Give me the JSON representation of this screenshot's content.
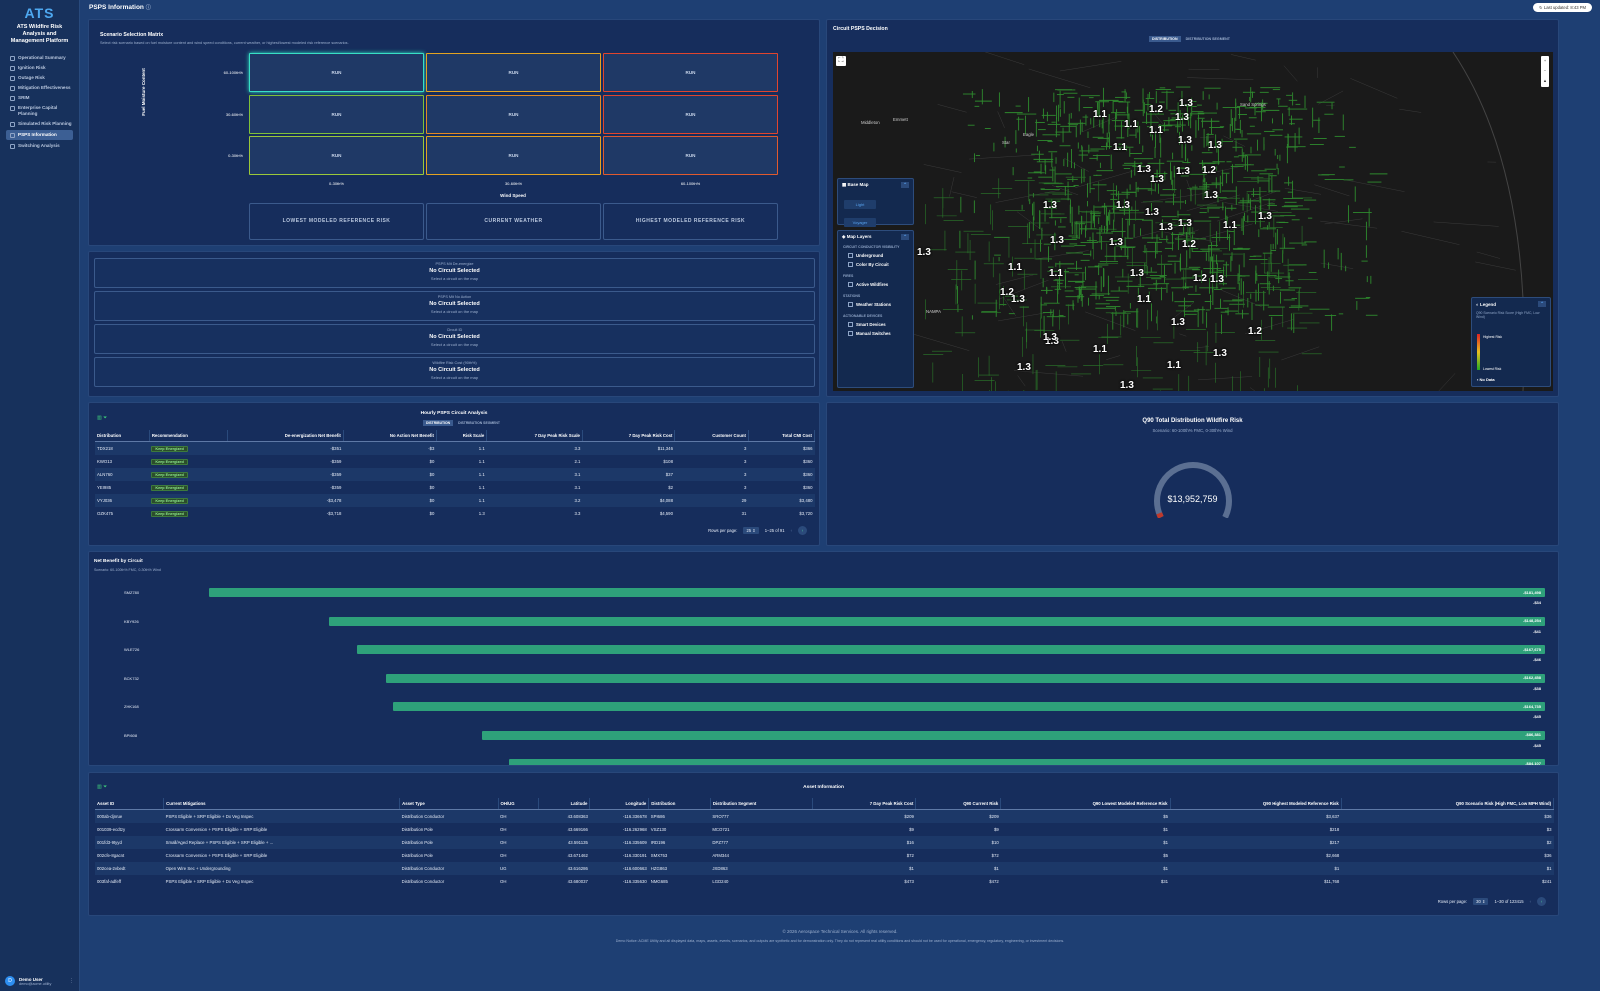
{
  "app": {
    "logo": "ATS",
    "title": "ATS Wildfire Risk Analysis and Management Platform"
  },
  "sidebar": {
    "items": [
      {
        "label": "Operational Summary"
      },
      {
        "label": "Ignition Risk"
      },
      {
        "label": "Outage Risk"
      },
      {
        "label": "Mitigation Effectiveness"
      },
      {
        "label": "SRIM"
      },
      {
        "label": "Enterprise Capital Planning"
      },
      {
        "label": "Simulated Risk Planning"
      },
      {
        "label": "PSPS Information"
      },
      {
        "label": "Switching Analysis"
      }
    ]
  },
  "user": {
    "initial": "D",
    "name": "Demo User",
    "email": "demo@acme.utility"
  },
  "header": {
    "title": "PSPS Information",
    "last_updated": "Last updated: 8:43 PM"
  },
  "matrix": {
    "title": "Scenario Selection Matrix",
    "subtitle": "Select risk scenario based on fuel moisture content and wind speed conditions, current weather, or highest/lowest modeled risk reference scenarios.",
    "y_label": "Fuel Moisture Content",
    "x_label": "Wind Speed",
    "row_labels": [
      "60-100th%",
      "30-60th%",
      "0-30th%"
    ],
    "col_labels": [
      "0-30th%",
      "30-60th%",
      "60-100th%"
    ],
    "cell_label": "RUN",
    "buttons": [
      "LOWEST MODELED REFERENCE RISK",
      "CURRENT WEATHER",
      "HIGHEST MODELED REFERENCE RISK"
    ]
  },
  "circuit_info": [
    {
      "label": "PSPS Mit De-energize",
      "value": "No Circuit Selected",
      "sub": "Select a circuit on the map"
    },
    {
      "label": "PSPS Mit No Action",
      "value": "No Circuit Selected",
      "sub": "Select a circuit on the map"
    },
    {
      "label": "Circuit ID",
      "value": "No Circuit Selected",
      "sub": "Select a circuit on the map"
    },
    {
      "label": "Wildfire Risk Cost (90th%)",
      "value": "No Circuit Selected",
      "sub": "Select a circuit on the map"
    }
  ],
  "decision": {
    "title": "Circuit PSPS Decision",
    "tabs": [
      "DISTRIBUTION",
      "DISTRIBUTION SEGMENT"
    ],
    "place_labels": [
      "Emmett",
      "Middleton",
      "Star",
      "Eagle",
      "NAMPA",
      "Sand Springs"
    ],
    "map_labels": [
      "1.3",
      "1.2",
      "1.3",
      "1.1",
      "1.1",
      "1.1",
      "1.3",
      "1.3",
      "1.1",
      "1.3",
      "1.3",
      "1.2",
      "1.3",
      "1.3",
      "1.3",
      "1.3",
      "1.3",
      "1.3",
      "1.3",
      "1.1",
      "1.1",
      "1.1",
      "1.3",
      "1.3",
      "1.3",
      "1.2",
      "1.3",
      "1.3",
      "1.3",
      "1.1",
      "1.2",
      "1.3",
      "1.2",
      "1.3",
      "1.3",
      "1.3",
      "1.1",
      "1.2",
      "1.3",
      "1.1",
      "1.3",
      "1.1",
      "1.3"
    ],
    "base_map": {
      "title": "Base Map",
      "options": [
        "Light",
        "Voyager",
        "Dark",
        "Satellite"
      ],
      "selected": "Dark"
    },
    "layers": {
      "title": "Map Layers",
      "groups": [
        {
          "name": "CIRCUIT CONDUCTOR VISIBILITY",
          "items": [
            "Underground",
            "Color By Circuit"
          ]
        },
        {
          "name": "FIRES",
          "items": [
            "Active Wildfires"
          ]
        },
        {
          "name": "STATIONS",
          "items": [
            "Weather Stations"
          ]
        },
        {
          "name": "ACTIONABLE DEVICES",
          "items": [
            "Smart Devices",
            "Manual Switches"
          ]
        }
      ]
    },
    "legend": {
      "title": "Legend",
      "subtitle": "Q90 Scenario Risk Score (High FMC, Low Wind)",
      "high": "Highest Risk",
      "low": "Lowest Risk",
      "no_data": "No Data"
    }
  },
  "hourly": {
    "title": "Hourly PSPS Circuit Analysis",
    "tabs": [
      "DISTRIBUTION",
      "DISTRIBUTION SEGMENT"
    ],
    "columns": [
      "Distribution",
      "Recommendation",
      "De-energization Net Benefit",
      "No Action Net Benefit",
      "Risk Scale",
      "7 Day Peak Risk Scale",
      "7 Day Peak Risk Cost",
      "Customer Count",
      "Total CMI Cost"
    ],
    "rows": [
      [
        "TDX218",
        "Keep Energized",
        "-$351",
        "-$3",
        "1.1",
        "3.3",
        "$11,346",
        "3",
        "$366"
      ],
      [
        "KWO13",
        "Keep Energized",
        "-$359",
        "$0",
        "1.1",
        "2.1",
        "$108",
        "3",
        "$360"
      ],
      [
        "ALN760",
        "Keep Energized",
        "-$359",
        "$0",
        "1.1",
        "3.1",
        "$37",
        "3",
        "$360"
      ],
      [
        "YEI985",
        "Keep Energized",
        "-$359",
        "$0",
        "1.1",
        "3.1",
        "$2",
        "3",
        "$360"
      ],
      [
        "VYJ036",
        "Keep Energized",
        "-$3,478",
        "$0",
        "1.1",
        "3.2",
        "$4,088",
        "29",
        "$3,480"
      ],
      [
        "OZK475",
        "Keep Energized",
        "-$3,718",
        "$0",
        "1.3",
        "3.3",
        "$4,590",
        "31",
        "$3,720"
      ]
    ],
    "pager": {
      "label": "Rows per page:",
      "size": "25",
      "range": "1–25 of 91"
    }
  },
  "gauge": {
    "title": "Q90 Total Distribution Wildfire Risk",
    "subtitle": "Scenario: 60-100th% FMC, 0-30th% Wind",
    "value": "$13,952,759",
    "fill_fraction": 0.03
  },
  "net_benefit": {
    "title": "Net Benefit by Circuit",
    "subtitle": "Scenario: 60-100th% FMC, 0-30th% Wind",
    "chart_data": {
      "type": "bar",
      "categories": [
        "SMZ780",
        "KBY926",
        "WLE726",
        "BCK732",
        "ZHK168",
        "BPI608",
        ""
      ],
      "series": [
        {
          "values": [
            -181498,
            -148254,
            -167675,
            -162458,
            -164735,
            -86381,
            -84107
          ]
        },
        {
          "values": [
            -34,
            -41,
            -46,
            -38,
            -45,
            -45,
            null
          ]
        }
      ],
      "value_labels": [
        "-$181,498",
        "-$148,254",
        "-$167,675",
        "-$162,458",
        "-$164,735",
        "-$86,381",
        "-$84,107"
      ],
      "secondary_labels": [
        "-$34",
        "-$41",
        "-$46",
        "-$38",
        "-$45",
        "-$45",
        ""
      ],
      "bar_fraction": [
        0.855,
        0.778,
        0.76,
        0.742,
        0.737,
        0.68,
        0.663
      ]
    }
  },
  "assets": {
    "title": "Asset Information",
    "columns": [
      "Asset ID",
      "Current Mitigations",
      "Asset Type",
      "OH/UG",
      "Latitude",
      "Longitude",
      "Distribution",
      "Distribution Segment",
      "7 Day Peak Risk Cost",
      "Q90 Current Risk",
      "Q90 Lowest Modeled Reference Risk",
      "Q90 Highest Modeled Reference Risk",
      "Q90 Scenario Risk (High FMC, Low MPH Wind)"
    ],
    "rows": [
      [
        "000ab-djnrue",
        "PSPS Eligible + SRP Eligible + Dx Veg Inspec",
        "Distribution Conductor",
        "OH",
        "43.608363",
        "-116.336678",
        "SPI686",
        "SRO777",
        "$209",
        "$209",
        "$5",
        "$3,637",
        "$36"
      ],
      [
        "001039-ecdtzy",
        "Crossarm Conversion + PSPS Eligible + SRP Eligible",
        "Distribution Pole",
        "OH",
        "43.669166",
        "-116.262968",
        "VSZ130",
        "MCO721",
        "$9",
        "$9",
        "$1",
        "$218",
        "$3"
      ],
      [
        "001fd3-9tyyd",
        "Small/Aged Replace + PSPS Eligible + SRP Eligible + ...",
        "Distribution Pole",
        "OH",
        "43.591135",
        "-116.335609",
        "IRD196",
        "DPZ777",
        "$16",
        "$10",
        "$1",
        "$217",
        "$2"
      ],
      [
        "002cfe-8gacnt",
        "Crossarm Conversion + PSPS Eligible + SRP Eligible",
        "Distribution Pole",
        "OH",
        "43.671462",
        "-116.330191",
        "SMX753",
        "ARM344",
        "$72",
        "$72",
        "$5",
        "$2,668",
        "$36"
      ],
      [
        "002cea-2vbedt",
        "Open Wire Sec + Undergrounding",
        "Distribution Conductor",
        "UG",
        "43.616286",
        "-116.600663",
        "HZG863",
        "JXD863",
        "$1",
        "$1",
        "$1",
        "$1",
        "$1"
      ],
      [
        "003faf-adfeff",
        "PSPS Eligible + SRP Eligible + Dx Veg Inspec",
        "Distribution Conductor",
        "OH",
        "43.680037",
        "-116.335630",
        "NMG685",
        "LGD240",
        "$473",
        "$472",
        "$31",
        "$11,768",
        "$241"
      ]
    ],
    "pager": {
      "label": "Rows per page:",
      "size": "30",
      "range": "1–30 of 123415"
    }
  },
  "footer": {
    "copyright": "© 2026 Aerospace Technical Services. All rights reserved.",
    "notice": "Demo Notice: ACME Utility and all displayed data, maps, assets, events, scenarios, and outputs are synthetic and for demonstration only. They do not represent real utility conditions and should not be used for operational, emergency, regulatory, engineering, or investment decisions."
  },
  "colors": {
    "accent": "#2ea17a",
    "bg": "#1e3f73",
    "panel": "#162d5c",
    "map_lines": "#2e8b2e"
  }
}
